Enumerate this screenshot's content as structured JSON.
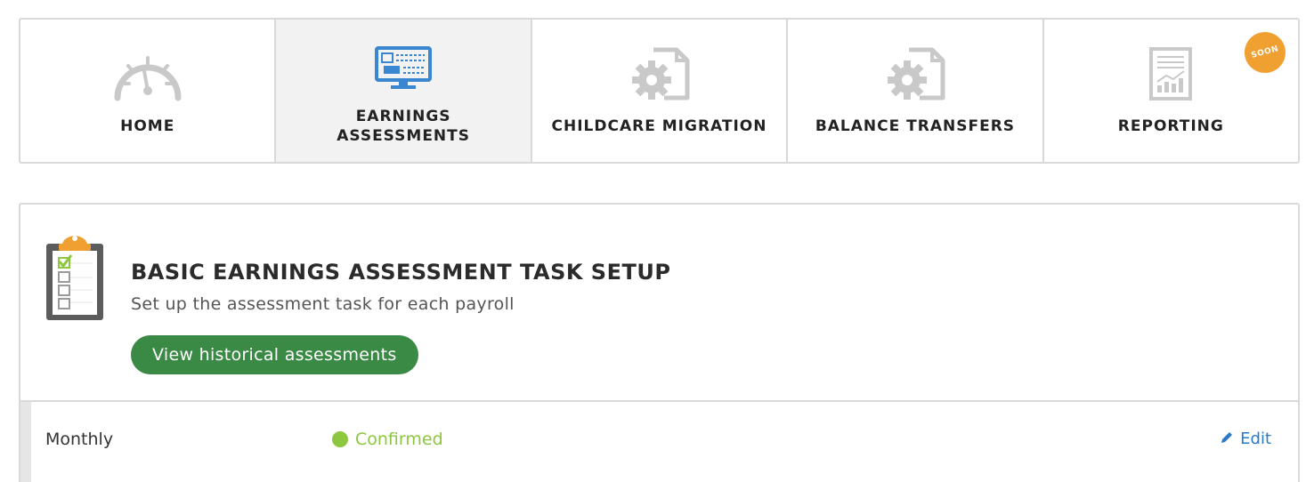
{
  "colors": {
    "accent_green": "#3a8a45",
    "status_green": "#8dc63f",
    "link_blue": "#2a7ac8",
    "badge_orange": "#f0a030",
    "active_tab_bg": "#f2f2f2"
  },
  "nav": {
    "tabs": [
      {
        "label": "HOME",
        "icon": "speedometer-icon",
        "active": false
      },
      {
        "label": "EARNINGS ASSESSMENTS",
        "icon": "monitor-icon",
        "active": true
      },
      {
        "label": "CHILDCARE MIGRATION",
        "icon": "gear-document-icon",
        "active": false
      },
      {
        "label": "BALANCE TRANSFERS",
        "icon": "gear-document-icon",
        "active": false
      },
      {
        "label": "REPORTING",
        "icon": "report-chart-icon",
        "active": false,
        "badge": "SOON"
      }
    ]
  },
  "task": {
    "icon": "clipboard-checklist-icon",
    "title": "BASIC EARNINGS ASSESSMENT TASK SETUP",
    "subtitle": "Set up the assessment task for each payroll",
    "history_button": "View historical assessments"
  },
  "payroll_rows": [
    {
      "period": "Monthly",
      "status": "Confirmed",
      "edit_label": "Edit",
      "edit_icon": "pencil-icon"
    }
  ]
}
